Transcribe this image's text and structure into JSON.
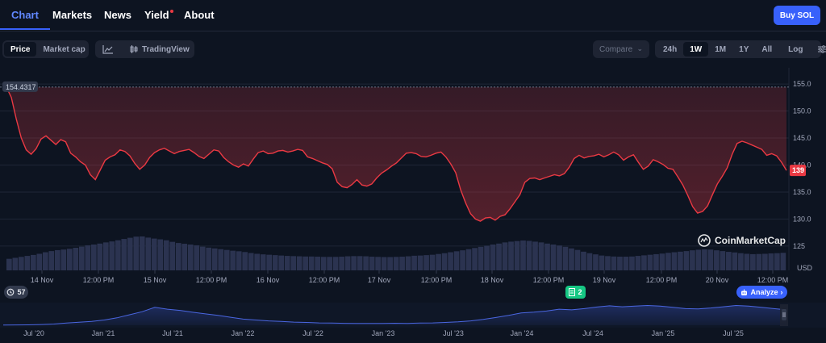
{
  "nav": {
    "tabs": [
      {
        "label": "Chart",
        "active": true
      },
      {
        "label": "Markets"
      },
      {
        "label": "News"
      },
      {
        "label": "Yield"
      },
      {
        "label": "About"
      }
    ],
    "buy_label": "Buy SOL"
  },
  "toolbar": {
    "metric_tabs": [
      "Price",
      "Market cap"
    ],
    "tradingview_label": "TradingView",
    "compare_placeholder": "Compare",
    "ranges": [
      "24h",
      "1W",
      "1M",
      "1Y",
      "All"
    ],
    "active_range": "1W",
    "log_label": "Log"
  },
  "colors": {
    "background": "#0d1421",
    "line": "#ea3943",
    "accent": "#3861fb",
    "volume": "#2b3350",
    "navigator": "#3a55c8",
    "events": "#16c784"
  },
  "chart_data": {
    "type": "line",
    "x_ticks": [
      "14 Nov",
      "12:00 PM",
      "15 Nov",
      "12:00 PM",
      "16 Nov",
      "12:00 PM",
      "17 Nov",
      "12:00 PM",
      "18 Nov",
      "12:00 PM",
      "19 Nov",
      "12:00 PM",
      "20 Nov",
      "12:00 PM"
    ],
    "y_ticks": [
      "155.0",
      "150.0",
      "145.0",
      "140.0",
      "135.0",
      "130.0",
      "125"
    ],
    "y_unit": "USD",
    "ylim": [
      120.5,
      158
    ],
    "high_label": "154.4317",
    "current_label": "139",
    "series": [
      {
        "values": [
          154.4,
          152.5,
          148.5,
          145.0,
          142.8,
          142.0,
          143.0,
          144.8,
          145.4,
          144.6,
          143.8,
          144.7,
          144.3,
          142.2,
          141.5,
          140.6,
          140.0,
          138.2,
          137.3,
          139.1,
          140.9,
          141.5,
          141.9,
          142.8,
          142.5,
          141.7,
          140.3,
          139.2,
          140.0,
          141.4,
          142.3,
          142.8,
          143.1,
          142.6,
          142.1,
          142.5,
          142.7,
          142.9,
          142.3,
          141.6,
          141.2,
          142.0,
          142.8,
          142.6,
          141.4,
          140.6,
          140.0,
          139.6,
          140.2,
          139.8,
          141.1,
          142.3,
          142.6,
          142.1,
          142.2,
          142.6,
          142.7,
          142.4,
          142.6,
          142.9,
          142.7,
          141.5,
          141.2,
          140.8,
          140.4,
          140.1,
          139.3,
          136.8,
          136.0,
          135.8,
          136.4,
          137.3,
          136.3,
          136.1,
          136.5,
          137.6,
          138.5,
          139.1,
          139.8,
          140.4,
          141.3,
          142.2,
          142.3,
          142.1,
          141.6,
          141.5,
          141.8,
          142.2,
          142.4,
          141.5,
          140.2,
          138.6,
          135.4,
          133.0,
          131.0,
          130.0,
          129.6,
          130.2,
          130.3,
          129.8,
          130.5,
          130.8,
          131.9,
          133.2,
          134.5,
          136.8,
          137.5,
          137.6,
          137.3,
          137.6,
          137.9,
          138.2,
          138.0,
          138.4,
          139.6,
          141.2,
          141.8,
          141.3,
          141.6,
          141.7,
          142.0,
          141.5,
          141.9,
          142.4,
          141.9,
          140.9,
          141.5,
          141.9,
          140.5,
          139.2,
          139.8,
          141.0,
          140.6,
          140.1,
          139.4,
          139.2,
          137.8,
          136.3,
          134.4,
          132.3,
          131.1,
          131.4,
          132.4,
          134.5,
          136.5,
          137.9,
          139.5,
          142.0,
          144.0,
          144.4,
          144.1,
          143.7,
          143.3,
          142.9,
          141.8,
          142.1,
          141.7,
          140.5,
          139.0
        ]
      }
    ],
    "volume": [
      6.0,
      6.5,
      7.0,
      7.5,
      8.0,
      8.6,
      9.4,
      10.0,
      10.5,
      10.8,
      11.2,
      11.7,
      12.3,
      13.0,
      13.4,
      13.9,
      14.5,
      15.0,
      15.6,
      16.3,
      16.9,
      17.5,
      17.6,
      17.0,
      16.5,
      16.1,
      15.6,
      14.8,
      14.2,
      13.8,
      13.4,
      13.0,
      12.3,
      11.8,
      11.4,
      11.0,
      10.6,
      10.2,
      9.9,
      9.5,
      9.0,
      8.6,
      8.3,
      8.1,
      7.9,
      7.7,
      7.5,
      7.4,
      7.3,
      7.2,
      7.2,
      7.1,
      7.0,
      7.0,
      7.0,
      7.1,
      7.3,
      7.4,
      7.4,
      7.3,
      7.1,
      7.0,
      6.9,
      6.9,
      7.0,
      7.1,
      7.3,
      7.6,
      7.7,
      7.9,
      8.1,
      8.5,
      8.9,
      9.4,
      9.9,
      10.4,
      11.0,
      11.6,
      12.2,
      12.8,
      13.4,
      13.9,
      14.5,
      14.9,
      15.2,
      15.5,
      15.3,
      14.9,
      14.5,
      13.9,
      13.4,
      12.9,
      12.2,
      11.4,
      10.6,
      9.7,
      8.9,
      8.3,
      7.7,
      7.4,
      7.2,
      7.1,
      7.1,
      7.2,
      7.5,
      7.8,
      8.1,
      8.4,
      8.7,
      9.1,
      9.4,
      9.7,
      10.0,
      10.4,
      10.7,
      10.9,
      10.8,
      10.4,
      10.0,
      9.6,
      9.3,
      8.9,
      8.6,
      8.4,
      8.5,
      8.6,
      8.8,
      8.9,
      9.1
    ]
  },
  "navigator": {
    "x_ticks": [
      "Jul '20",
      "Jan '21",
      "Jul '21",
      "Jan '22",
      "Jul '22",
      "Jan '23",
      "Jul '23",
      "Jan '24",
      "Jul '24",
      "Jan '25",
      "Jul '25"
    ],
    "values": [
      0.4,
      0.5,
      0.6,
      1.2,
      2.0,
      3.5,
      4.8,
      6.2,
      8.5,
      12.0,
      17.0,
      22.0,
      29.0,
      26.0,
      24.0,
      21.0,
      18.5,
      16.0,
      13.0,
      10.0,
      8.5,
      7.0,
      6.3,
      5.1,
      4.6,
      3.8,
      3.6,
      3.2,
      3.0,
      2.9,
      2.9,
      3.3,
      3.0,
      3.5,
      3.8,
      4.6,
      5.5,
      7.0,
      9.5,
      12.5,
      16.0,
      20.0,
      21.2,
      23.0,
      26.0,
      25.0,
      27.0,
      29.5,
      31.5,
      30.0,
      31.0,
      32.0,
      31.0,
      29.0,
      27.0,
      26.5,
      28.0,
      30.0,
      32.0,
      31.0,
      29.0,
      27.0,
      25.0
    ],
    "ylim": [
      0,
      34
    ]
  },
  "event_badges": {
    "alerts_count": "57",
    "news_count": "2",
    "analyze_label": "Analyze"
  }
}
